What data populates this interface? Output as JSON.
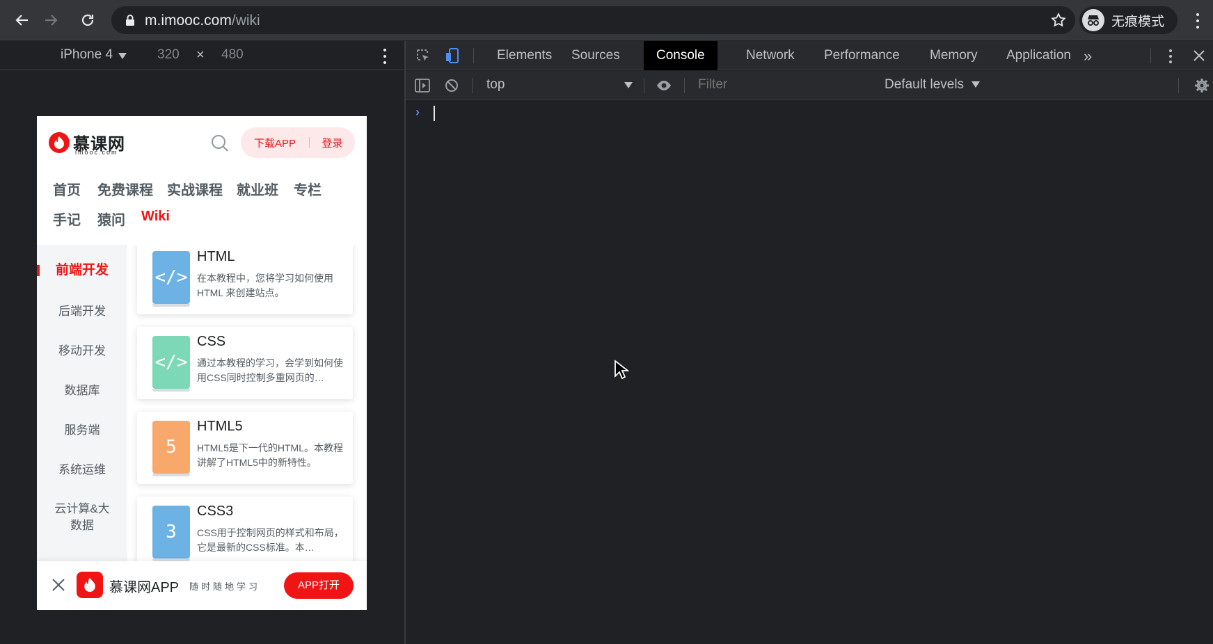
{
  "browser": {
    "url_host": "m.imooc.com",
    "url_path": "/wiki",
    "incognito_label": "无痕模式"
  },
  "device_toolbar": {
    "device": "iPhone 4",
    "width": "320",
    "times": "×",
    "height": "480"
  },
  "mobile": {
    "logo_text": "慕课网",
    "logo_sub": "imooc.com",
    "download_app": "下载APP",
    "login": "登录",
    "nav": [
      "首页",
      "免费课程",
      "实战课程",
      "就业班",
      "专栏",
      "手记",
      "猿问",
      "Wiki"
    ],
    "active_nav": "Wiki",
    "sidebar": [
      "前端开发",
      "后端开发",
      "移动开发",
      "数据库",
      "服务端",
      "系统运维",
      "云计算&大数据"
    ],
    "cards": [
      {
        "title": "HTML",
        "desc": "在本教程中，您将学习如何使用 HTML 来创建站点。",
        "icon": "</>",
        "color": "#6cb2e4"
      },
      {
        "title": "CSS",
        "desc": "通过本教程的学习，会学到如何使用CSS同时控制多重网页的…",
        "icon": "</>",
        "color": "#7cd8b6"
      },
      {
        "title": "HTML5",
        "desc": "HTML5是下一代的HTML。本教程讲解了HTML5中的新特性。",
        "icon": "5",
        "color": "#f9a86b"
      },
      {
        "title": "CSS3",
        "desc": "CSS用于控制网页的样式和布局，它是最新的CSS标准。本…",
        "icon": "3",
        "color": "#6cb2e4"
      }
    ],
    "footer": {
      "app_name": "慕课网APP",
      "slogan": "随时随地学习",
      "open_button": "APP打开"
    }
  },
  "devtools": {
    "tabs": [
      "Elements",
      "Sources",
      "Console",
      "Network",
      "Performance",
      "Memory",
      "Application"
    ],
    "active_tab": "Console",
    "more_tabs": "»",
    "context": "top",
    "filter_placeholder": "Filter",
    "levels": "Default levels",
    "prompt": "›"
  },
  "colors": {
    "accent": "#f01414",
    "devtools_bg": "#202124",
    "toolbar_bg": "#35363a"
  }
}
